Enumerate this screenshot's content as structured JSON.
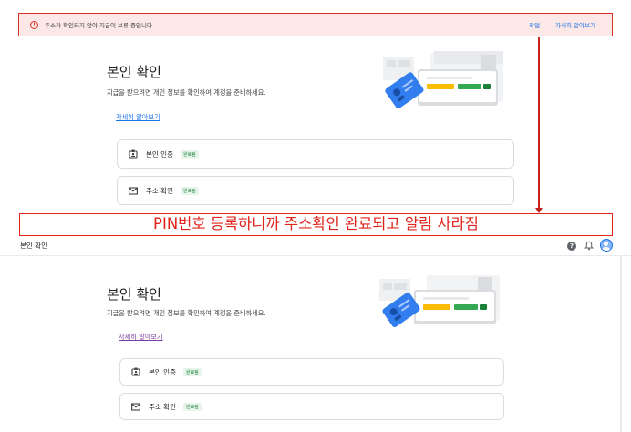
{
  "top_banner": {
    "message": "주소가 확인되지 않아 지급이 보류 중입니다",
    "action_label": "작업",
    "learn_more_label": "자세히 알아보기",
    "colors": {
      "border": "#d93025",
      "background": "#fce8e6"
    }
  },
  "annotation": {
    "text": "PIN번호 등록하니까 주소확인 완료되고 알림 사라짐",
    "color": "#e0241b"
  },
  "before": {
    "title": "본인 확인",
    "description": "지급을 받으려면 개인 정보를 확인하여 계정을 준비하세요.",
    "learn_more": "자세히 알아보기",
    "cards": [
      {
        "label": "본인 인증",
        "badge": "완료됨",
        "icon": "id-badge-icon"
      },
      {
        "label": "주소 확인",
        "badge": "완료됨",
        "icon": "mail-icon"
      }
    ]
  },
  "after": {
    "appbar_title": "본인 확인",
    "title": "본인 확인",
    "description": "지급을 받으려면 개인 정보를 확인하여 계정을 준비하세요.",
    "learn_more": "자세히 알아보기",
    "cards": [
      {
        "label": "본인 인증",
        "badge": "완료됨",
        "icon": "id-badge-icon"
      },
      {
        "label": "주소 확인",
        "badge": "완료됨",
        "icon": "mail-icon"
      }
    ],
    "header_icons": [
      "help-icon",
      "bell-icon",
      "avatar"
    ]
  }
}
